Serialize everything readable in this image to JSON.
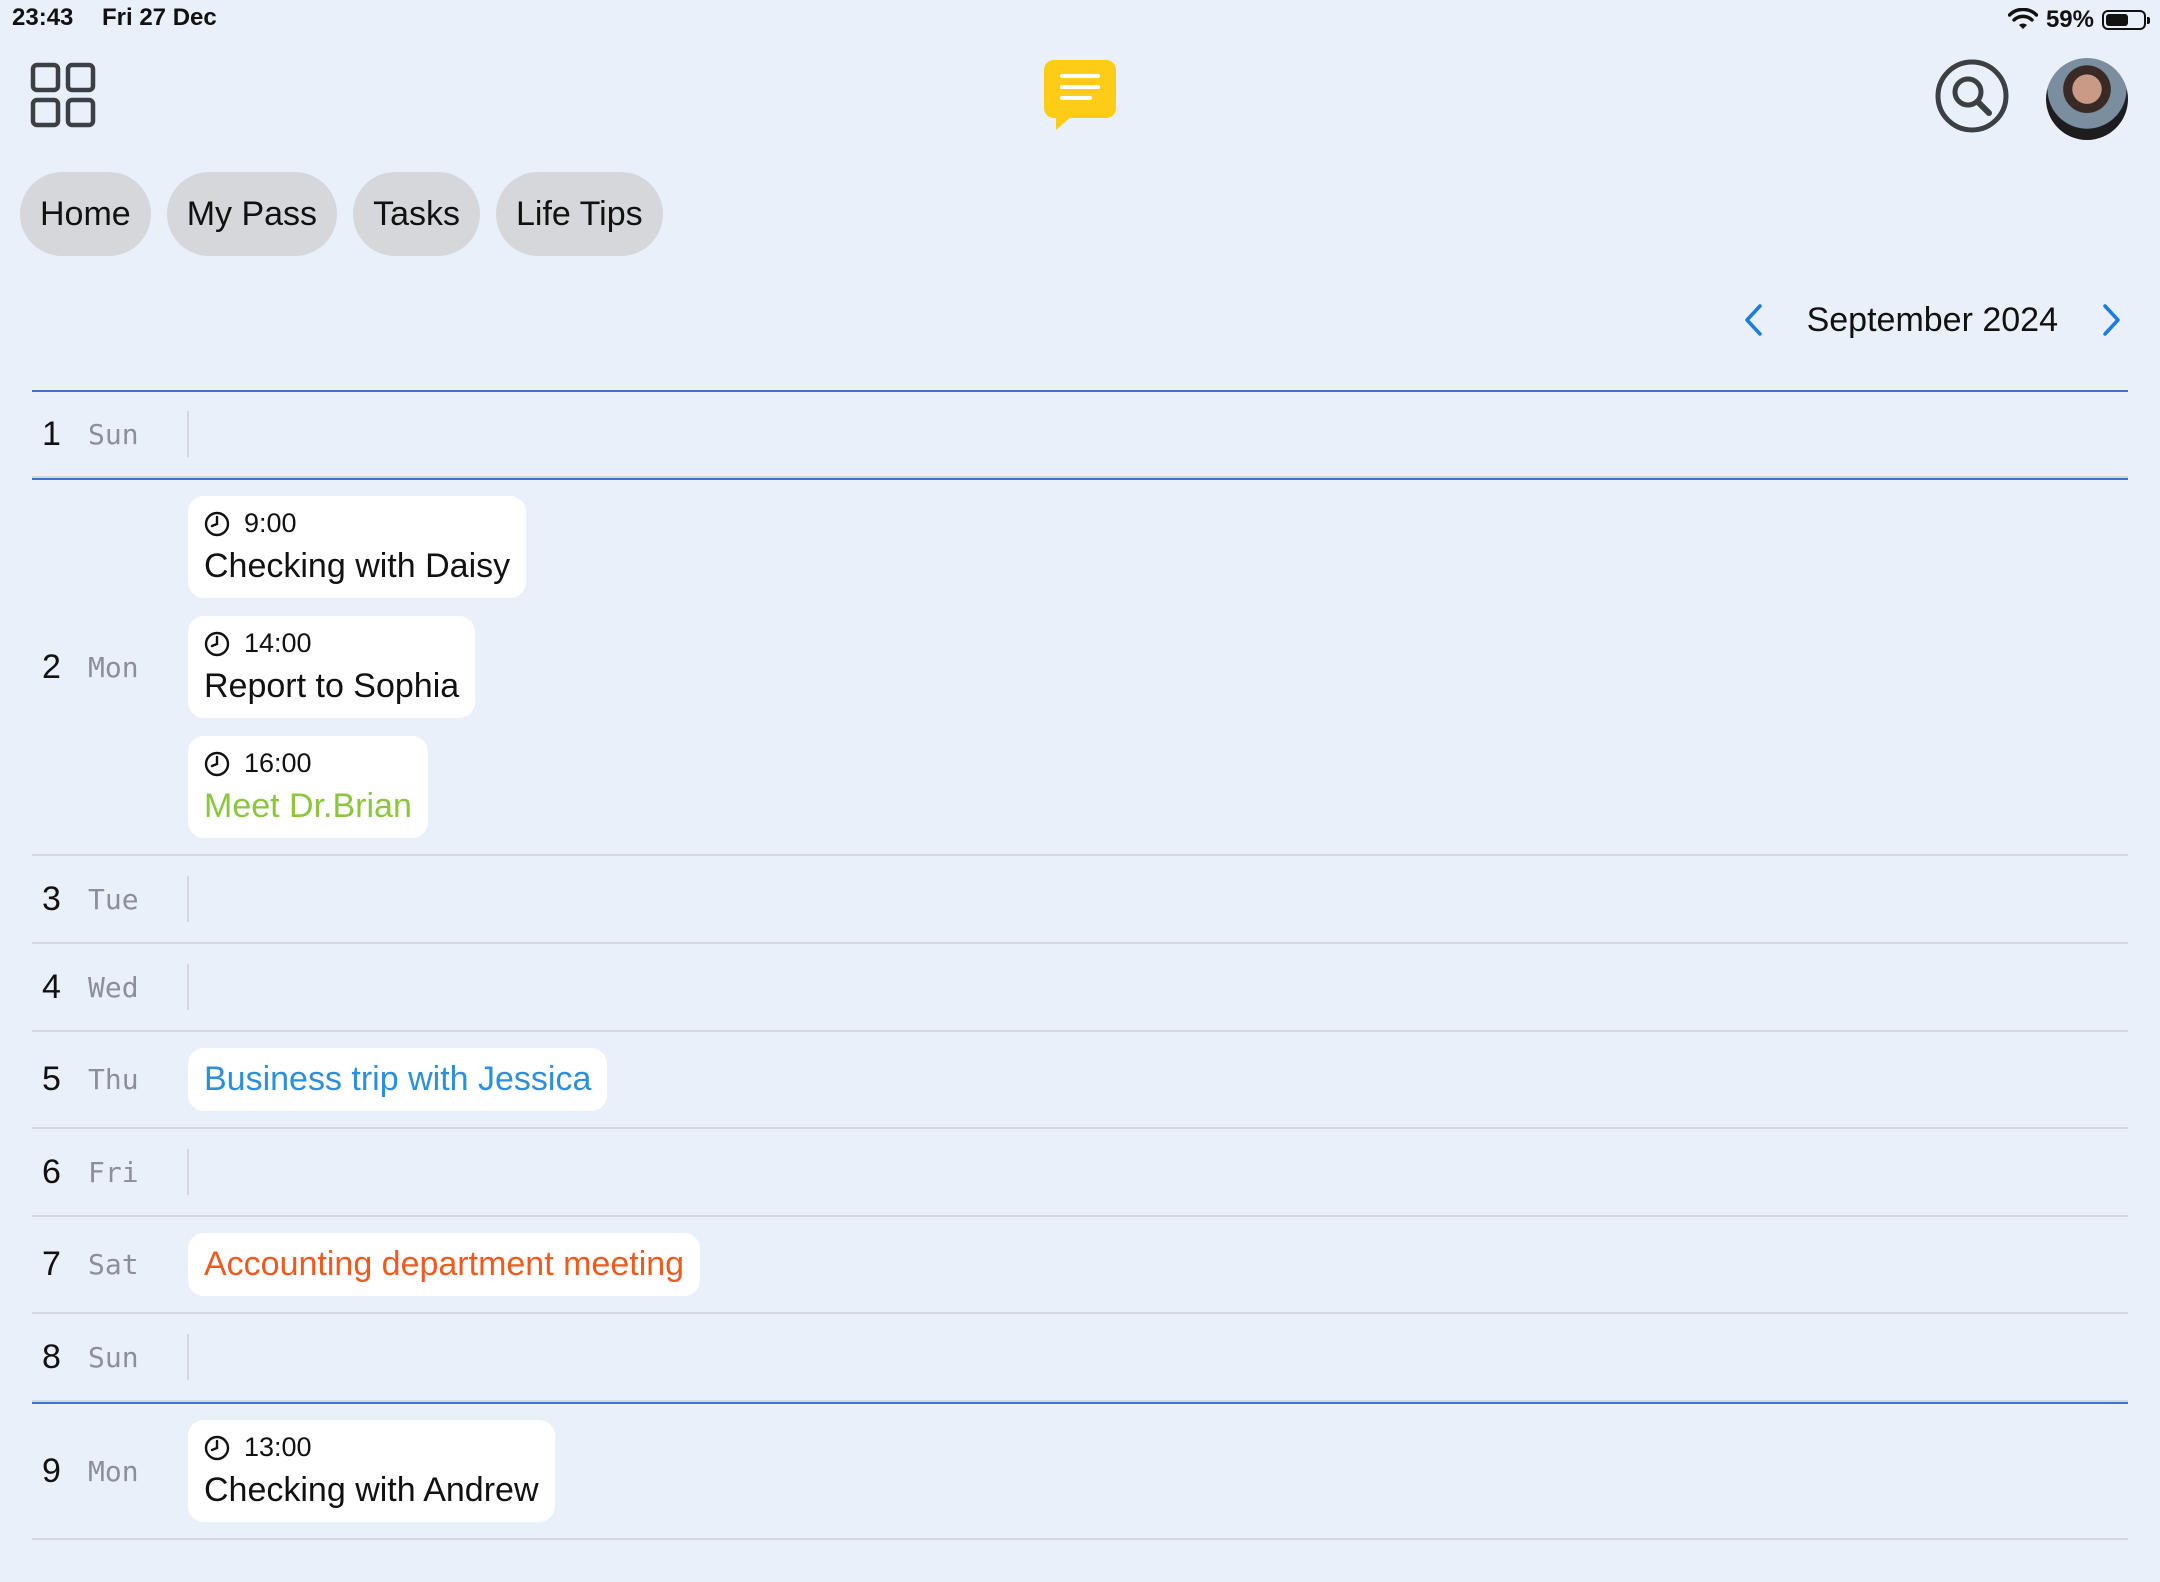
{
  "status_bar": {
    "time": "23:43",
    "date": "Fri 27 Dec",
    "battery": "59%",
    "battery_level": 0.59
  },
  "topbar": {
    "menu_icon": "grid-icon",
    "center_icon": "chat-bubble-icon",
    "search_icon": "search-icon",
    "avatar": "user-avatar"
  },
  "tabs": [
    {
      "label": "Home"
    },
    {
      "label": "My Pass"
    },
    {
      "label": "Tasks"
    },
    {
      "label": "Life Tips"
    }
  ],
  "calendar": {
    "month_label": "September 2024",
    "accent_color": "#1a7be0",
    "days": [
      {
        "num": "1",
        "name": "Sun",
        "events": []
      },
      {
        "num": "2",
        "name": "Mon",
        "events": [
          {
            "time": "9:00",
            "title": "Checking with Daisy",
            "color": "#111111"
          },
          {
            "time": "14:00",
            "title": "Report to Sophia",
            "color": "#111111"
          },
          {
            "time": "16:00",
            "title": "Meet Dr.Brian",
            "color": "#8cc63f"
          }
        ]
      },
      {
        "num": "3",
        "name": "Tue",
        "events": []
      },
      {
        "num": "4",
        "name": "Wed",
        "events": []
      },
      {
        "num": "5",
        "name": "Thu",
        "events": [
          {
            "time": "",
            "title": "Business trip with Jessica",
            "color": "#2b8fdc"
          }
        ]
      },
      {
        "num": "6",
        "name": "Fri",
        "events": []
      },
      {
        "num": "7",
        "name": "Sat",
        "events": [
          {
            "time": "",
            "title": "Accounting department meeting",
            "color": "#f05a1e"
          }
        ]
      },
      {
        "num": "8",
        "name": "Sun",
        "events": []
      },
      {
        "num": "9",
        "name": "Mon",
        "events": [
          {
            "time": "13:00",
            "title": "Checking with Andrew",
            "color": "#111111"
          }
        ]
      }
    ]
  }
}
